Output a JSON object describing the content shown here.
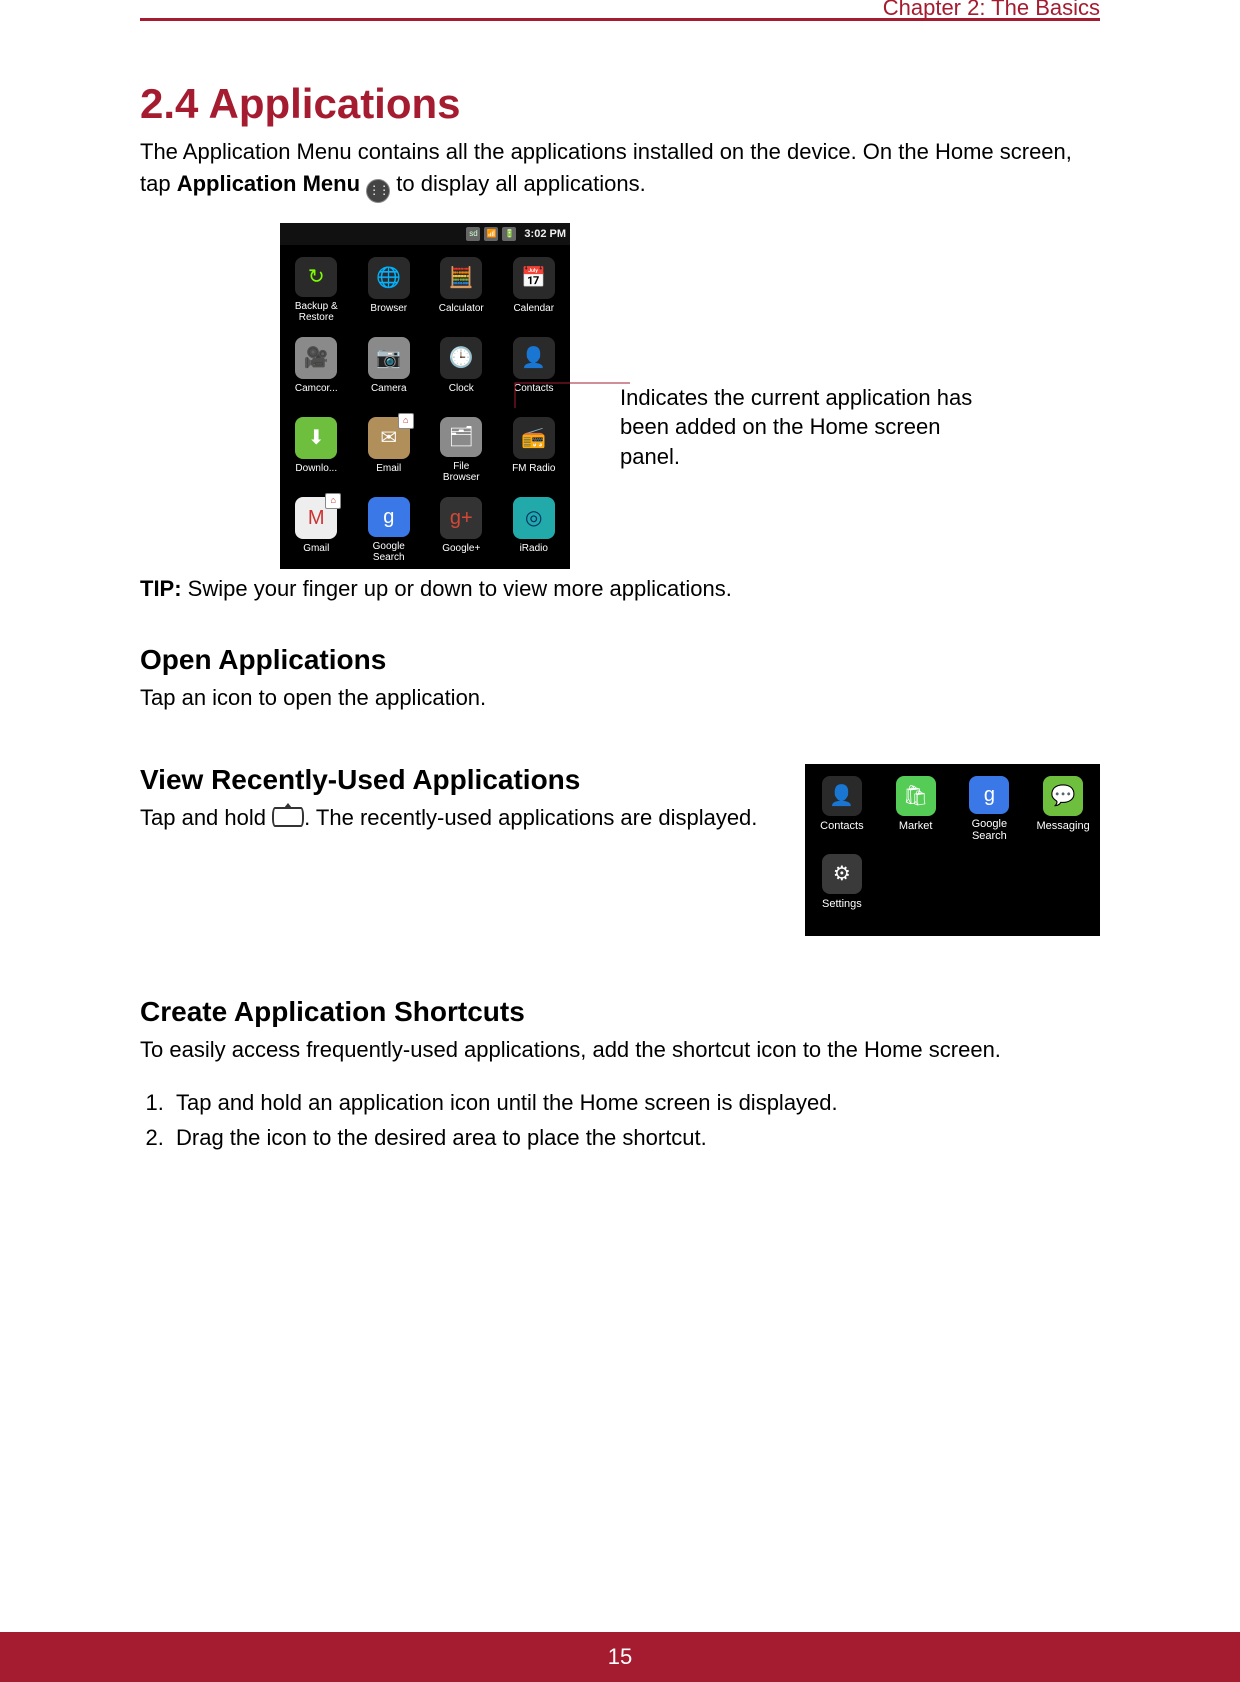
{
  "header": {
    "chapter": "Chapter 2: The Basics"
  },
  "section": {
    "title": "2.4 Applications",
    "intro_a": "The Application Menu contains all the applications installed on the device. On the Home screen, tap ",
    "intro_b": "Application Menu",
    "intro_c": " to display all applications."
  },
  "phone": {
    "time": "3:02 PM",
    "apps": [
      {
        "name": "Backup &\nRestore",
        "icon": "↻",
        "bg": "#2a2a2a",
        "fg": "#7cfc00"
      },
      {
        "name": "Browser",
        "icon": "🌐",
        "bg": "#2a2a2a"
      },
      {
        "name": "Calculator",
        "icon": "🧮",
        "bg": "#2a2a2a"
      },
      {
        "name": "Calendar",
        "icon": "📅",
        "bg": "#2a2a2a"
      },
      {
        "name": "Camcor...",
        "icon": "🎥",
        "bg": "#8a8a8a"
      },
      {
        "name": "Camera",
        "icon": "📷",
        "bg": "#8a8a8a"
      },
      {
        "name": "Clock",
        "icon": "🕒",
        "bg": "#2a2a2a"
      },
      {
        "name": "Contacts",
        "icon": "👤",
        "bg": "#2a2a2a"
      },
      {
        "name": "Downlo...",
        "icon": "⬇",
        "bg": "#6fbf3f"
      },
      {
        "name": "Email",
        "icon": "✉",
        "bg": "#b08f5a",
        "home": true
      },
      {
        "name": "File\nBrowser",
        "icon": "🗂",
        "bg": "#8a8a8a"
      },
      {
        "name": "FM Radio",
        "icon": "📻",
        "bg": "#2a2a2a"
      },
      {
        "name": "Gmail",
        "icon": "M",
        "bg": "#eee",
        "fg": "#c33",
        "home": true
      },
      {
        "name": "Google\nSearch",
        "icon": "g",
        "bg": "#3b78e7",
        "fg": "#fff"
      },
      {
        "name": "Google+",
        "icon": "g+",
        "bg": "#333",
        "fg": "#d34836"
      },
      {
        "name": "iRadio",
        "icon": "◎",
        "bg": "#2aa",
        "fg": "#036"
      }
    ]
  },
  "callout": "Indicates the current application has been added on the Home screen panel.",
  "tip": {
    "label": "TIP:",
    "text": " Swipe your finger up or down to view more applications."
  },
  "open": {
    "heading": "Open Applications",
    "text": "Tap an icon to open the application."
  },
  "recent": {
    "heading": "View Recently-Used Applications",
    "text_a": "Tap and hold ",
    "text_b": ". The recently-used applications are displayed.",
    "apps": [
      {
        "name": "Contacts",
        "icon": "👤",
        "bg": "#2a2a2a"
      },
      {
        "name": "Market",
        "icon": "🛍",
        "bg": "#5c5"
      },
      {
        "name": "Google\nSearch",
        "icon": "g",
        "bg": "#3b78e7",
        "fg": "#fff"
      },
      {
        "name": "Messaging",
        "icon": "💬",
        "bg": "#6fbf3f"
      },
      {
        "name": "Settings",
        "icon": "⚙",
        "bg": "#3a3a3a"
      }
    ]
  },
  "shortcuts": {
    "heading": "Create Application Shortcuts",
    "intro": "To easily access frequently-used applications, add the shortcut icon to the Home screen.",
    "steps": [
      "Tap and hold an application icon until the Home screen is displayed.",
      "Drag the icon to the desired area to place the shortcut."
    ]
  },
  "footer": {
    "page": "15"
  }
}
